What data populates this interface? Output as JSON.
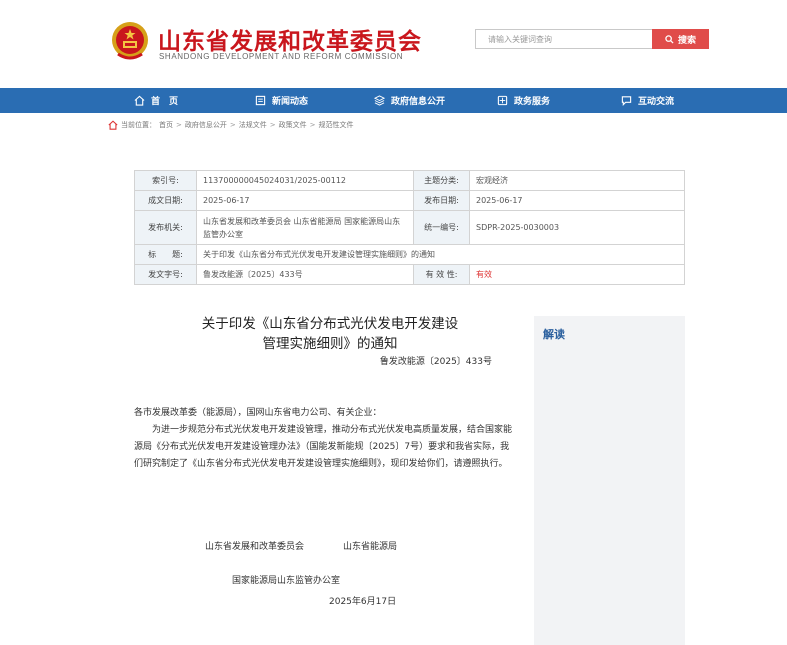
{
  "header": {
    "title": "山东省发展和改革委员会",
    "subtitle": "SHANDONG DEVELOPMENT AND REFORM COMMISSION",
    "logo_icon": "national-emblem-icon"
  },
  "search": {
    "placeholder": "请输入关键词查询",
    "button_label": "搜索"
  },
  "colors": {
    "brand_red": "#c9161d",
    "nav_blue": "#2a6db3",
    "search_red": "#e04c4a"
  },
  "nav": {
    "items": [
      {
        "label": "首　页",
        "icon": "home-icon"
      },
      {
        "label": "新闻动态",
        "icon": "news-icon"
      },
      {
        "label": "政府信息公开",
        "icon": "layers-icon"
      },
      {
        "label": "政务服务",
        "icon": "service-icon"
      },
      {
        "label": "互动交流",
        "icon": "chat-icon"
      }
    ]
  },
  "breadcrumb": {
    "prefix": "当前位置：",
    "items": [
      "首页",
      "政府信息公开",
      "法规文件",
      "政策文件",
      "规范性文件"
    ]
  },
  "meta": {
    "index_no_label": "索引号:",
    "index_no": "11370000004502403​1/2025-00112",
    "category_label": "主题分类:",
    "category": "宏观经济",
    "created_label": "成文日期:",
    "created": "2025-06-17",
    "published_label": "发布日期:",
    "published": "2025-06-17",
    "issuer_label": "发布机关:",
    "issuer": "山东省发展和改革委员会 山东省能源局 国家能源局山东监管办公室",
    "unified_no_label": "统一编号:",
    "unified_no": "SDPR-2025-0030003",
    "title_label": "标　　题:",
    "title": "关于印发《山东省分布式光伏发电开发建设管理实施细则》的通知",
    "doc_no_label": "发文字号:",
    "doc_no": "鲁发改能源〔2025〕433号",
    "validity_label": "有 效 性:",
    "validity": "有效"
  },
  "doc": {
    "title_line1": "关于印发《山东省分布式光伏发电开发建设",
    "title_line2": "管理实施细则》的通知",
    "number": "鲁发改能源〔2025〕433号",
    "addressee": "各市发展改革委（能源局），国网山东省电力公司、有关企业：",
    "paragraph": "为进一步规范分布式光伏发电开发建设管理，推动分布式光伏发电高质量发展，结合国家能源局《分布式光伏发电开发建设管理办法》（国能发新能规〔2025〕7号）要求和我省实际，我们研究制定了《山东省分布式光伏发电开发建设管理实施细则》，现印发给你们，请遵照执行。",
    "signer1": "山东省发展和改革委员会",
    "signer2": "山东省能源局",
    "signer3": "国家能源局山东监管办公室",
    "date": "2025年6月17日"
  },
  "sidebar": {
    "title": "解读"
  }
}
